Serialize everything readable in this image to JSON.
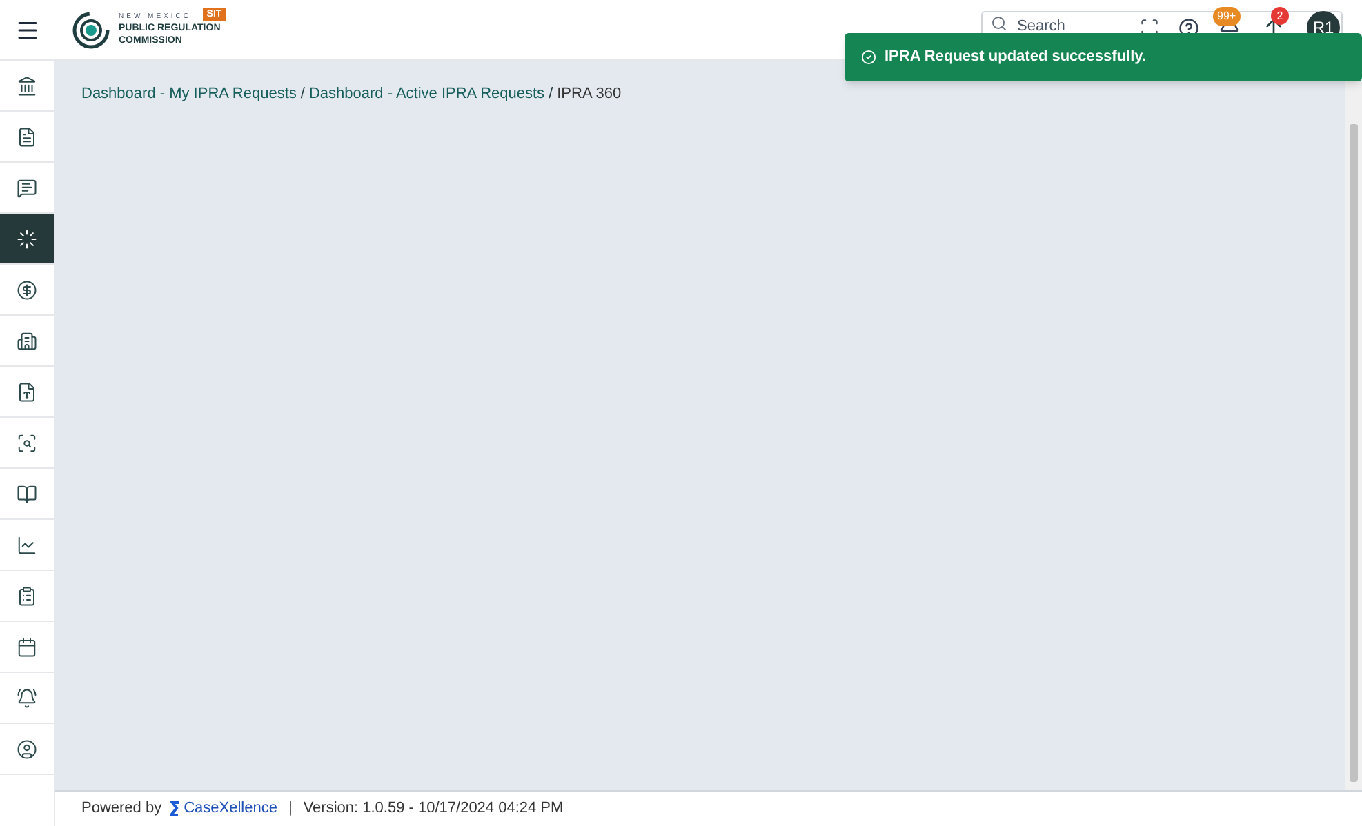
{
  "header": {
    "logo": {
      "line_1": "NEW MEXICO",
      "line_2": "PUBLIC REGULATION",
      "line_3": "COMMISSION",
      "badge": "SIT"
    },
    "search": {
      "placeholder": "Search"
    },
    "notifications_badge": "99+",
    "uploads_badge": "2",
    "avatar": "R1"
  },
  "sidebar": {
    "items": [
      {
        "selected": false
      },
      {
        "selected": false
      },
      {
        "selected": false
      },
      {
        "selected": true
      },
      {
        "selected": false
      },
      {
        "selected": false
      },
      {
        "selected": false
      },
      {
        "selected": false
      },
      {
        "selected": false
      },
      {
        "selected": false
      },
      {
        "selected": false
      },
      {
        "selected": false
      },
      {
        "selected": false
      },
      {
        "selected": false
      }
    ]
  },
  "breadcrumb_separator": "/",
  "breadcrumb": [
    {
      "label": "Dashboard - My IPRA Requests",
      "link": true
    },
    {
      "label": "Dashboard - Active IPRA Requests",
      "link": true
    },
    {
      "label": "IPRA 360",
      "link": false
    }
  ],
  "toast": {
    "message": "IPRA Request updated successfully."
  },
  "footer": {
    "powered_by": "Powered by",
    "brand": "CaseXellence",
    "separator": "|",
    "version": "Version: 1.0.59 - 10/17/2024 04:24 PM"
  }
}
